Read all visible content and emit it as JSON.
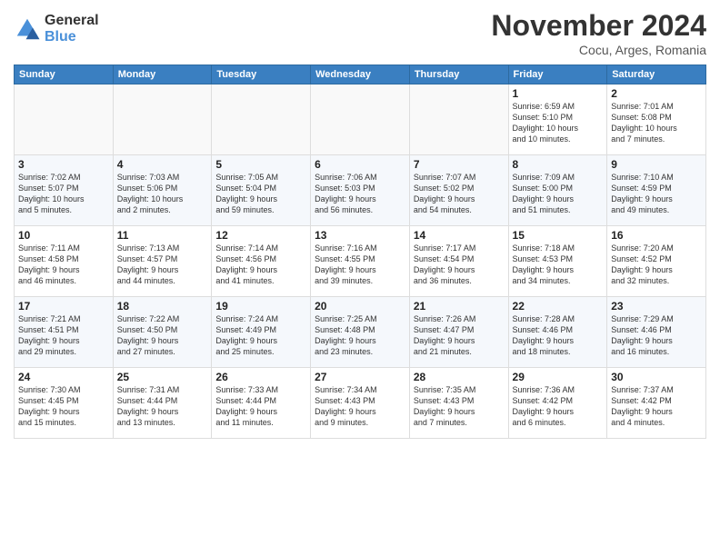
{
  "header": {
    "logo_general": "General",
    "logo_blue": "Blue",
    "month_title": "November 2024",
    "location": "Cocu, Arges, Romania"
  },
  "days_of_week": [
    "Sunday",
    "Monday",
    "Tuesday",
    "Wednesday",
    "Thursday",
    "Friday",
    "Saturday"
  ],
  "weeks": [
    [
      {
        "day": "",
        "info": ""
      },
      {
        "day": "",
        "info": ""
      },
      {
        "day": "",
        "info": ""
      },
      {
        "day": "",
        "info": ""
      },
      {
        "day": "",
        "info": ""
      },
      {
        "day": "1",
        "info": "Sunrise: 6:59 AM\nSunset: 5:10 PM\nDaylight: 10 hours\nand 10 minutes."
      },
      {
        "day": "2",
        "info": "Sunrise: 7:01 AM\nSunset: 5:08 PM\nDaylight: 10 hours\nand 7 minutes."
      }
    ],
    [
      {
        "day": "3",
        "info": "Sunrise: 7:02 AM\nSunset: 5:07 PM\nDaylight: 10 hours\nand 5 minutes."
      },
      {
        "day": "4",
        "info": "Sunrise: 7:03 AM\nSunset: 5:06 PM\nDaylight: 10 hours\nand 2 minutes."
      },
      {
        "day": "5",
        "info": "Sunrise: 7:05 AM\nSunset: 5:04 PM\nDaylight: 9 hours\nand 59 minutes."
      },
      {
        "day": "6",
        "info": "Sunrise: 7:06 AM\nSunset: 5:03 PM\nDaylight: 9 hours\nand 56 minutes."
      },
      {
        "day": "7",
        "info": "Sunrise: 7:07 AM\nSunset: 5:02 PM\nDaylight: 9 hours\nand 54 minutes."
      },
      {
        "day": "8",
        "info": "Sunrise: 7:09 AM\nSunset: 5:00 PM\nDaylight: 9 hours\nand 51 minutes."
      },
      {
        "day": "9",
        "info": "Sunrise: 7:10 AM\nSunset: 4:59 PM\nDaylight: 9 hours\nand 49 minutes."
      }
    ],
    [
      {
        "day": "10",
        "info": "Sunrise: 7:11 AM\nSunset: 4:58 PM\nDaylight: 9 hours\nand 46 minutes."
      },
      {
        "day": "11",
        "info": "Sunrise: 7:13 AM\nSunset: 4:57 PM\nDaylight: 9 hours\nand 44 minutes."
      },
      {
        "day": "12",
        "info": "Sunrise: 7:14 AM\nSunset: 4:56 PM\nDaylight: 9 hours\nand 41 minutes."
      },
      {
        "day": "13",
        "info": "Sunrise: 7:16 AM\nSunset: 4:55 PM\nDaylight: 9 hours\nand 39 minutes."
      },
      {
        "day": "14",
        "info": "Sunrise: 7:17 AM\nSunset: 4:54 PM\nDaylight: 9 hours\nand 36 minutes."
      },
      {
        "day": "15",
        "info": "Sunrise: 7:18 AM\nSunset: 4:53 PM\nDaylight: 9 hours\nand 34 minutes."
      },
      {
        "day": "16",
        "info": "Sunrise: 7:20 AM\nSunset: 4:52 PM\nDaylight: 9 hours\nand 32 minutes."
      }
    ],
    [
      {
        "day": "17",
        "info": "Sunrise: 7:21 AM\nSunset: 4:51 PM\nDaylight: 9 hours\nand 29 minutes."
      },
      {
        "day": "18",
        "info": "Sunrise: 7:22 AM\nSunset: 4:50 PM\nDaylight: 9 hours\nand 27 minutes."
      },
      {
        "day": "19",
        "info": "Sunrise: 7:24 AM\nSunset: 4:49 PM\nDaylight: 9 hours\nand 25 minutes."
      },
      {
        "day": "20",
        "info": "Sunrise: 7:25 AM\nSunset: 4:48 PM\nDaylight: 9 hours\nand 23 minutes."
      },
      {
        "day": "21",
        "info": "Sunrise: 7:26 AM\nSunset: 4:47 PM\nDaylight: 9 hours\nand 21 minutes."
      },
      {
        "day": "22",
        "info": "Sunrise: 7:28 AM\nSunset: 4:46 PM\nDaylight: 9 hours\nand 18 minutes."
      },
      {
        "day": "23",
        "info": "Sunrise: 7:29 AM\nSunset: 4:46 PM\nDaylight: 9 hours\nand 16 minutes."
      }
    ],
    [
      {
        "day": "24",
        "info": "Sunrise: 7:30 AM\nSunset: 4:45 PM\nDaylight: 9 hours\nand 15 minutes."
      },
      {
        "day": "25",
        "info": "Sunrise: 7:31 AM\nSunset: 4:44 PM\nDaylight: 9 hours\nand 13 minutes."
      },
      {
        "day": "26",
        "info": "Sunrise: 7:33 AM\nSunset: 4:44 PM\nDaylight: 9 hours\nand 11 minutes."
      },
      {
        "day": "27",
        "info": "Sunrise: 7:34 AM\nSunset: 4:43 PM\nDaylight: 9 hours\nand 9 minutes."
      },
      {
        "day": "28",
        "info": "Sunrise: 7:35 AM\nSunset: 4:43 PM\nDaylight: 9 hours\nand 7 minutes."
      },
      {
        "day": "29",
        "info": "Sunrise: 7:36 AM\nSunset: 4:42 PM\nDaylight: 9 hours\nand 6 minutes."
      },
      {
        "day": "30",
        "info": "Sunrise: 7:37 AM\nSunset: 4:42 PM\nDaylight: 9 hours\nand 4 minutes."
      }
    ]
  ]
}
